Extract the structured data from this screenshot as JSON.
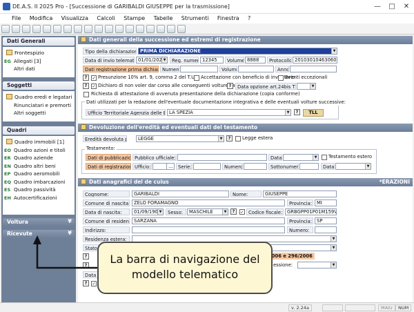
{
  "window": {
    "title": "DE.A.S. II 2025 Pro - [Successione di GARIBALDI GIUSEPPE per la trasmissione]",
    "minimize": "—",
    "maximize": "□",
    "close": "✕"
  },
  "menu": [
    "File",
    "Modifica",
    "Visualizza",
    "Calcoli",
    "Stampe",
    "Tabelle",
    "Strumenti",
    "Finestra",
    "?"
  ],
  "sidebar": {
    "dati_generali": {
      "title": "Dati Generali",
      "items": [
        {
          "key": "",
          "label": "Frontespizio"
        },
        {
          "key": "EG",
          "label": "Allegati [3]"
        },
        {
          "key": "",
          "label": "Altri dati"
        }
      ]
    },
    "soggetti": {
      "title": "Soggetti",
      "items": [
        "Quadro eredi e legatari [2]",
        "Rinunciatari e premorti",
        "Altri soggetti"
      ]
    },
    "quadri": {
      "title": "Quadri",
      "items": [
        {
          "key": "",
          "label": "Quadro immobili [1]"
        },
        {
          "key": "EO",
          "label": "Quadro azioni e titoli"
        },
        {
          "key": "ER",
          "label": "Quadro aziende"
        },
        {
          "key": "EN",
          "label": "Quadro altri beni"
        },
        {
          "key": "EP",
          "label": "Quadro aeromobili"
        },
        {
          "key": "EQ",
          "label": "Quadro imbarcazioni"
        },
        {
          "key": "ES",
          "label": "Quadro passività"
        },
        {
          "key": "EH",
          "label": "Autocertificazioni"
        }
      ]
    },
    "voltura": "Voltura",
    "ricevute": "Ricevute"
  },
  "panel1": {
    "title": "Dati generali della successione ed estremi di registrazione",
    "tipo_label": "Tipo della dichiarazione:",
    "tipo_value": "PRIMA DICHIARAZIONE",
    "data_invio_label": "Data di invio telematico:",
    "data_invio": "01/01/2025",
    "reg_numero_label": "Reg. numero:",
    "reg_numero": "12345",
    "volume_label": "Volume:",
    "volume": "8888",
    "protocollo_label": "Protocollo:",
    "protocollo": "20103010463060521",
    "data_reg_label": "Dati registrazione prima dichiarazione:",
    "numero_label": "Numero:",
    "volume2_label": "Volume:",
    "anno_label": "Anno:",
    "presunzione": "Presunzione 10% art. 9, comma 2 del T.U.",
    "accettazione": "Accettazione con beneficio di inventario",
    "eventi": "Eventi eccezionali",
    "dichiaro": "Dichiaro di non voler dar corso alle conseguenti volture catastali",
    "opzione_label": "Data opzione art.24bis TUIR:",
    "attestazione": "Richiesta di attestazione di avvenuta presentazione della dichiarazione (copia conforme)",
    "dati_utilizzati": "Dati utilizzati per la redazione dell'eventuale documentazione integrativa e delle eventuali volture successive:",
    "ufficio_label": "Ufficio Territoriale Agenzia delle Entrate:",
    "ufficio_value": "LA SPEZIA",
    "ufficio_code": "TLL"
  },
  "panel2": {
    "title": "Devoluzione dell'eredità ed eventuali dati del testamento",
    "devoluta_label": "Eredità devoluta per:",
    "devoluta_value": "LEGGE",
    "legge_estera": "Legge estera",
    "testamento": "Testamento:",
    "data_pubbl": "Dati di pubblicazione:",
    "pubblico_uff": "Pubblico ufficiale:",
    "data1": "Data:",
    "testamento_estero": "Testamento estero",
    "dati_reg": "Dati di registrazione",
    "ufficio": "Ufficio:",
    "serie": "Serie:",
    "numero": "Numero:",
    "sottonumero": "Sottonumero:",
    "data2": "Data:"
  },
  "panel3": {
    "title": "Dati anagrafici del de cuius",
    "right_tag": "*ERAZIONI",
    "cognome_label": "Cognome:",
    "cognome": "GARIBALDI",
    "nome_label": "Nome:",
    "nome": "GIUSEPPE",
    "comune_nascita_label": "Comune di nascita:",
    "comune_nascita": "ZELO FORAMAGNO",
    "provincia_label": "Provincia:",
    "provincia_nascita": "MI",
    "data_nascita_label": "Data di nascita:",
    "data_nascita": "01/09/1901",
    "sesso_label": "Sesso:",
    "sesso": "MASCHILE",
    "cf_label": "Codice fiscale:",
    "cf": "GRBGPP01P01M159V",
    "comune_res_label": "Comune di residenza:",
    "comune_res": "SARZANA",
    "provincia_res_label": "Provincia:",
    "provincia_res": "SP",
    "indirizzo_label": "Indirizzo:",
    "numero_label": "Numero:",
    "residenza_estera_label": "Residenza estera:",
    "stato_label": "Stato c",
    "leggi": "2006 e 296/2006",
    "successione_label": "essione:",
    "data_label": "Data d"
  },
  "status": {
    "version": "v. 2.24a",
    "maiu": "MAIU",
    "num": "NUM"
  },
  "callout": {
    "text": "La barra di navigazione del modello telematico"
  }
}
